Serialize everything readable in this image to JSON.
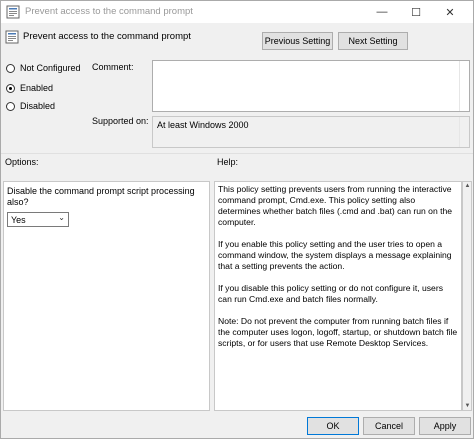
{
  "window": {
    "title": "Prevent access to the command prompt"
  },
  "header": {
    "title": "Prevent access to the command prompt",
    "previous_label": "Previous Setting",
    "next_label": "Next Setting"
  },
  "state": {
    "options": [
      {
        "label": "Not Configured",
        "selected": false
      },
      {
        "label": "Enabled",
        "selected": true
      },
      {
        "label": "Disabled",
        "selected": false
      }
    ]
  },
  "comment": {
    "label": "Comment:",
    "value": ""
  },
  "supported": {
    "label": "Supported on:",
    "value": "At least Windows 2000"
  },
  "options_section": {
    "label": "Options:",
    "question": "Disable the command prompt script processing also?",
    "select_value": "Yes"
  },
  "help": {
    "label": "Help:",
    "paragraphs": [
      "This policy setting prevents users from running the interactive command prompt, Cmd.exe.  This policy setting also determines whether batch files (.cmd and .bat) can run on the computer.",
      "If you enable this policy setting and the user tries to open a command window, the system displays a message explaining that a setting prevents the action.",
      "If you disable this policy setting or do not configure it, users can run Cmd.exe and batch files normally.",
      "Note: Do not prevent the computer from running batch files if the computer uses logon, logoff, startup, or shutdown batch file scripts, or for users that use Remote Desktop Services."
    ]
  },
  "footer": {
    "ok_label": "OK",
    "cancel_label": "Cancel",
    "apply_label": "Apply"
  }
}
